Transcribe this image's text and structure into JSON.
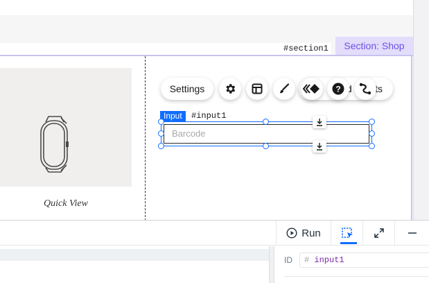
{
  "section": {
    "id_tag": "#section1",
    "tag_label": "Section: Shop"
  },
  "product": {
    "quick_view_label": "Quick View",
    "image_icon": "watch-icon"
  },
  "toolbar": {
    "settings_label": "Settings",
    "connect_label": "nd  Pr   ts",
    "icons": [
      "gear-icon",
      "layout-icon",
      "brush-icon",
      "code-diamond-icon",
      "help-icon",
      "animation-icon"
    ]
  },
  "input": {
    "type_label": "Input",
    "id_tag": "#input1",
    "placeholder": "Barcode"
  },
  "dev_panel": {
    "run_label": "Run",
    "prop_id_label": "ID",
    "prop_id_hash": "#",
    "prop_id_value": "input1"
  },
  "colors": {
    "selection_blue": "#116dff",
    "section_purple": "#6b53e8",
    "section_bg": "#e3dcfb"
  }
}
